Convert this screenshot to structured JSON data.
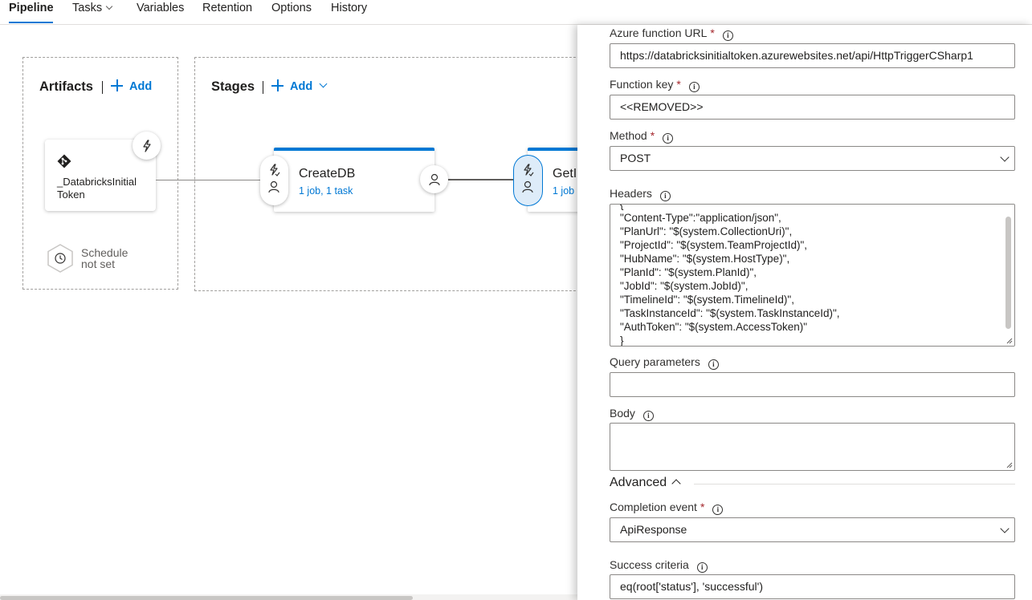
{
  "tabs": [
    {
      "label": "Pipeline"
    },
    {
      "label": "Tasks"
    },
    {
      "label": "Variables"
    },
    {
      "label": "Retention"
    },
    {
      "label": "Options"
    },
    {
      "label": "History"
    }
  ],
  "artifacts": {
    "title": "Artifacts",
    "add_label": "Add",
    "artifact_name": "_DatabricksInitial Token",
    "schedule_line1": "Schedule",
    "schedule_line2": "not set"
  },
  "stages": {
    "title": "Stages",
    "add_label": "Add",
    "items": [
      {
        "name": "CreateDB",
        "summary": "1 job, 1 task"
      },
      {
        "name": "GetI",
        "summary": "1 job"
      }
    ]
  },
  "panel": {
    "azure_function_url": {
      "label": "Azure function URL",
      "required": "*",
      "value": "https://databricksinitialtoken.azurewebsites.net/api/HttpTriggerCSharp1"
    },
    "function_key": {
      "label": "Function key",
      "required": "*",
      "value": "<<REMOVED>>"
    },
    "method": {
      "label": "Method",
      "required": "*",
      "value": "POST"
    },
    "headers": {
      "label": "Headers",
      "value": "{\n\"Content-Type\":\"application/json\",\n\"PlanUrl\": \"$(system.CollectionUri)\",\n\"ProjectId\": \"$(system.TeamProjectId)\",\n\"HubName\": \"$(system.HostType)\",\n\"PlanId\": \"$(system.PlanId)\",\n\"JobId\": \"$(system.JobId)\",\n\"TimelineId\": \"$(system.TimelineId)\",\n\"TaskInstanceId\": \"$(system.TaskInstanceId)\",\n\"AuthToken\": \"$(system.AccessToken)\"\n}"
    },
    "query_parameters": {
      "label": "Query parameters",
      "value": ""
    },
    "body": {
      "label": "Body",
      "value": ""
    },
    "advanced": {
      "label": "Advanced"
    },
    "completion_event": {
      "label": "Completion event",
      "required": "*",
      "value": "ApiResponse"
    },
    "success_criteria": {
      "label": "Success criteria",
      "value": "eq(root['status'], 'successful')"
    }
  },
  "colors": {
    "accent": "#0078d4",
    "required": "#a4262c"
  }
}
